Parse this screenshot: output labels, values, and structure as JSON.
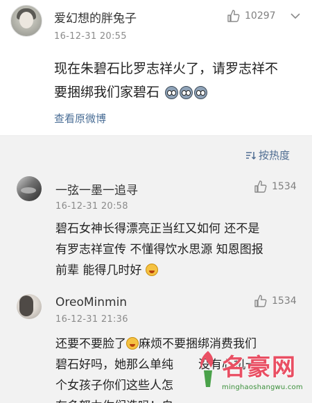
{
  "post": {
    "username": "爱幻想的胖兔子",
    "time": "16-12-31 20:55",
    "likes": "10297",
    "text": "现在朱碧石比罗志祥火了，请罗志祥不要捆绑我们家碧石",
    "view_original": "查看原微博"
  },
  "sort": {
    "label": "按热度",
    "icon": "sort-icon"
  },
  "comments": [
    {
      "username": "一弦一墨一追寻",
      "time": "16-12-31 20:58",
      "likes": "1534",
      "lines": [
        "碧石女神长得漂亮正当红又如何 还不是",
        "有罗志祥宣传 不懂得饮水思源 知恩图报",
        "前辈 能得几时好"
      ]
    },
    {
      "username": "OreoMinmin",
      "time": "16-12-31 21:36",
      "likes": "1534",
      "lines": [
        "还要不要脸了",
        "麻烦不要捆绑消费我们",
        "碧石好吗，她那么单纯",
        "没有心机一",
        "个女孩子你们这些人怎",
        "有多努力你们造吗！自"
      ]
    }
  ],
  "watermark": {
    "title": "名豪网",
    "url": "minghaoshangwu.com"
  },
  "colors": {
    "link": "#4a6e96",
    "background": "#f2f2f2",
    "watermark": "#e94f63"
  }
}
